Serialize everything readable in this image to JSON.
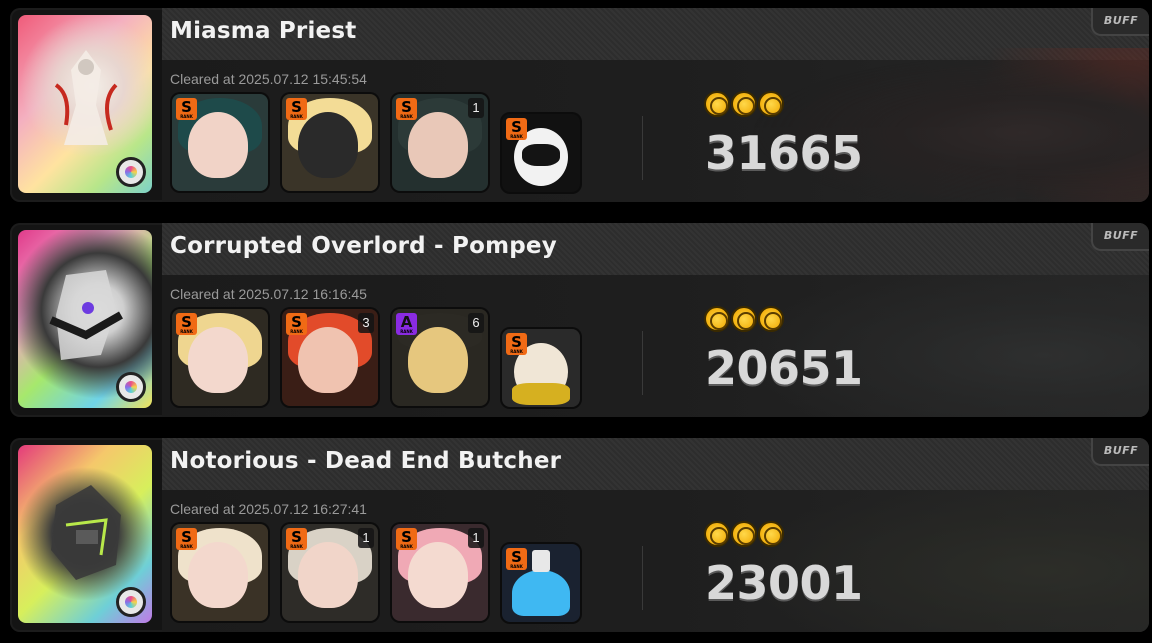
{
  "entries": [
    {
      "boss_name": "Miasma Priest",
      "buff_label": "BUFF",
      "cleared_text": "Cleared at 2025.07.12 15:45:54",
      "score": "31665",
      "stars": 3,
      "agents": [
        {
          "rank": "S",
          "mindscape": "",
          "palette": [
            "#1e4a4a",
            "#f1d3c7"
          ]
        },
        {
          "rank": "S",
          "mindscape": "",
          "palette": [
            "#f3dc96",
            "#2a2a2a"
          ]
        },
        {
          "rank": "S",
          "mindscape": "1",
          "palette": [
            "#2c3a38",
            "#e9c8b8"
          ]
        }
      ],
      "bangboo": {
        "rank": "S",
        "mindscape": "",
        "palette": [
          "#f2f2f2",
          "#141414"
        ]
      }
    },
    {
      "boss_name": "Corrupted Overlord - Pompey",
      "buff_label": "BUFF",
      "cleared_text": "Cleared at 2025.07.12 16:16:45",
      "score": "20651",
      "stars": 3,
      "agents": [
        {
          "rank": "S",
          "mindscape": "",
          "palette": [
            "#efd690",
            "#f3d8cd"
          ]
        },
        {
          "rank": "S",
          "mindscape": "3",
          "palette": [
            "#e24b2a",
            "#f0c3b0"
          ]
        },
        {
          "rank": "A",
          "mindscape": "6",
          "palette": [
            "#e6c77e",
            "#2c2a24"
          ]
        }
      ],
      "bangboo": {
        "rank": "S",
        "mindscape": "",
        "palette": [
          "#f0e6d6",
          "#d6b020"
        ]
      }
    },
    {
      "boss_name": "Notorious - Dead End Butcher",
      "buff_label": "BUFF",
      "cleared_text": "Cleared at 2025.07.12 16:27:41",
      "score": "23001",
      "stars": 3,
      "agents": [
        {
          "rank": "S",
          "mindscape": "",
          "palette": [
            "#efe2cb",
            "#f3d8cd"
          ]
        },
        {
          "rank": "S",
          "mindscape": "1",
          "palette": [
            "#d9d2c6",
            "#f1d5c9"
          ]
        },
        {
          "rank": "S",
          "mindscape": "1",
          "palette": [
            "#f0a9b5",
            "#f4dad0"
          ]
        }
      ],
      "bangboo": {
        "rank": "S",
        "mindscape": "",
        "palette": [
          "#3fb8f2",
          "#e8e8e8"
        ]
      }
    }
  ]
}
